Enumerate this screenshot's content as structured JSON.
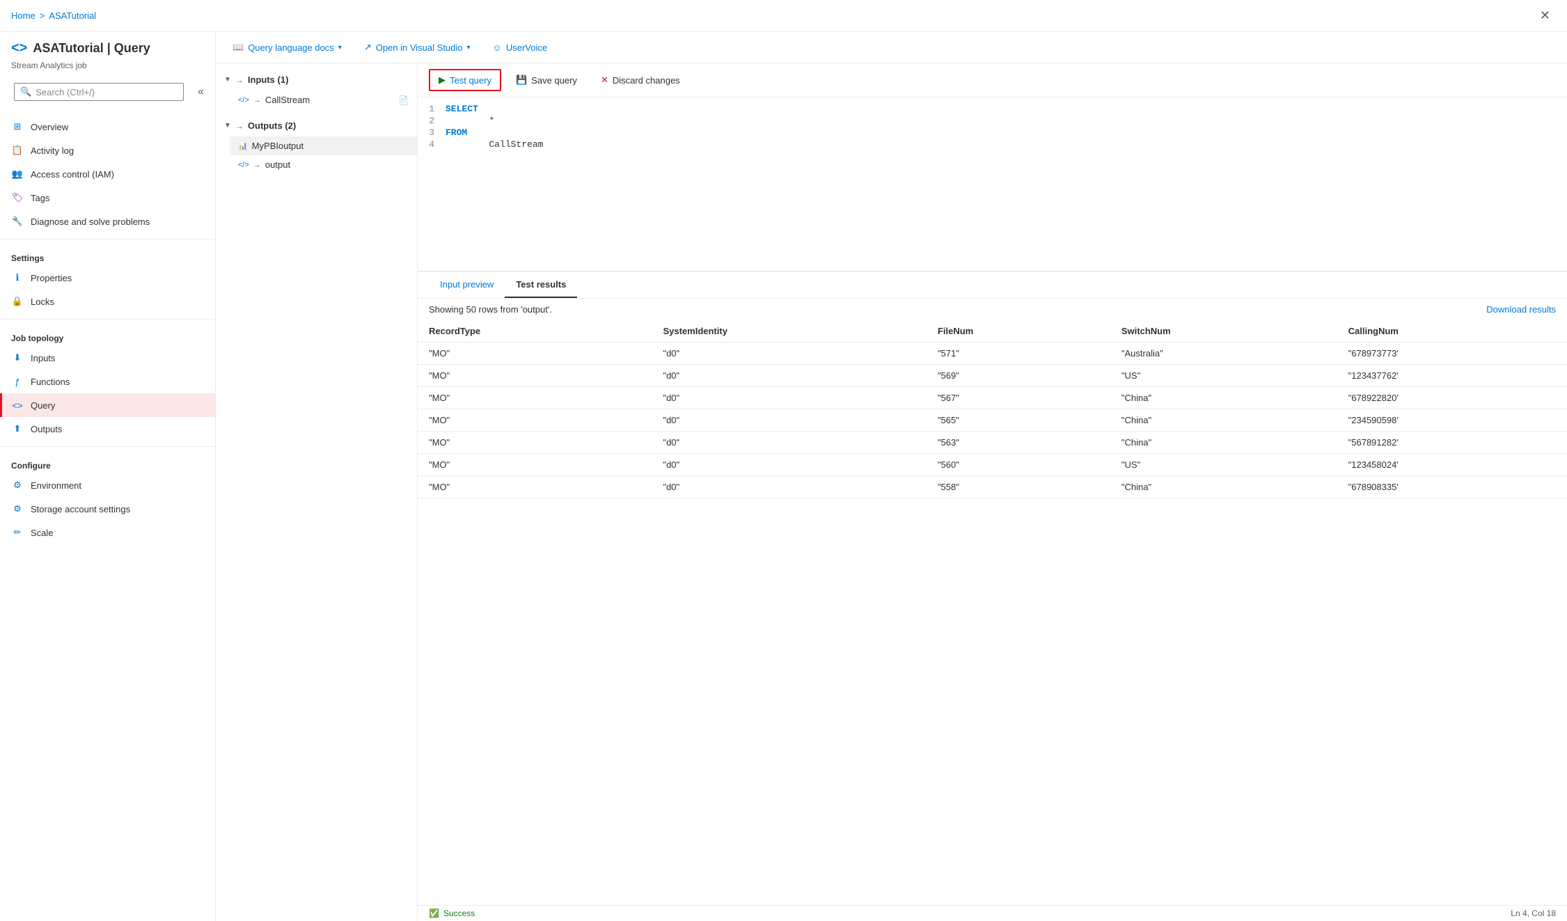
{
  "breadcrumb": {
    "home": "Home",
    "separator": ">",
    "current": "ASATutorial"
  },
  "header": {
    "icon": "<>",
    "title": "ASATutorial | Query",
    "subtitle": "Stream Analytics job",
    "print_icon": "🖨"
  },
  "search": {
    "placeholder": "Search (Ctrl+/)"
  },
  "nav": {
    "top_items": [
      {
        "id": "overview",
        "label": "Overview",
        "icon": "grid"
      },
      {
        "id": "activity-log",
        "label": "Activity log",
        "icon": "list"
      },
      {
        "id": "access-control",
        "label": "Access control (IAM)",
        "icon": "people"
      },
      {
        "id": "tags",
        "label": "Tags",
        "icon": "tag"
      },
      {
        "id": "diagnose",
        "label": "Diagnose and solve problems",
        "icon": "wrench"
      }
    ],
    "settings_label": "Settings",
    "settings_items": [
      {
        "id": "properties",
        "label": "Properties",
        "icon": "info"
      },
      {
        "id": "locks",
        "label": "Locks",
        "icon": "lock"
      }
    ],
    "job_topology_label": "Job topology",
    "job_topology_items": [
      {
        "id": "inputs",
        "label": "Inputs",
        "icon": "input"
      },
      {
        "id": "functions",
        "label": "Functions",
        "icon": "functions"
      },
      {
        "id": "query",
        "label": "Query",
        "icon": "query",
        "active": true
      },
      {
        "id": "outputs",
        "label": "Outputs",
        "icon": "output"
      }
    ],
    "configure_label": "Configure",
    "configure_items": [
      {
        "id": "environment",
        "label": "Environment",
        "icon": "env"
      },
      {
        "id": "storage-account-settings",
        "label": "Storage account settings",
        "icon": "storage"
      },
      {
        "id": "scale",
        "label": "Scale",
        "icon": "scale"
      }
    ]
  },
  "toolbar_top": {
    "query_docs_label": "Query language docs",
    "open_vs_label": "Open in Visual Studio",
    "uservoice_label": "UserVoice"
  },
  "query_toolbar": {
    "test_query_label": "Test query",
    "save_query_label": "Save query",
    "discard_changes_label": "Discard changes"
  },
  "tree": {
    "inputs_label": "Inputs (1)",
    "inputs_items": [
      {
        "id": "callstream",
        "label": "CallStream",
        "has_file": true
      }
    ],
    "outputs_label": "Outputs (2)",
    "outputs_items": [
      {
        "id": "mypbloutput",
        "label": "MyPBIoutput"
      },
      {
        "id": "output",
        "label": "output"
      }
    ]
  },
  "code": {
    "lines": [
      {
        "num": "1",
        "tokens": [
          {
            "text": "SELECT",
            "class": "kw-select"
          }
        ]
      },
      {
        "num": "2",
        "tokens": [
          {
            "text": "        *",
            "class": "code-text"
          }
        ]
      },
      {
        "num": "3",
        "tokens": [
          {
            "text": "FROM",
            "class": "kw-from"
          }
        ]
      },
      {
        "num": "4",
        "tokens": [
          {
            "text": "        CallStream",
            "class": "code-text"
          }
        ]
      }
    ]
  },
  "results": {
    "tabs": [
      {
        "id": "input-preview",
        "label": "Input preview",
        "active": false
      },
      {
        "id": "test-results",
        "label": "Test results",
        "active": true
      }
    ],
    "info_text": "Showing 50 rows from 'output'.",
    "download_label": "Download results",
    "columns": [
      "RecordType",
      "SystemIdentity",
      "FileNum",
      "SwitchNum",
      "CallingNum"
    ],
    "rows": [
      [
        "\"MO\"",
        "\"d0\"",
        "\"571\"",
        "\"Australia\"",
        "\"678973773'"
      ],
      [
        "\"MO\"",
        "\"d0\"",
        "\"569\"",
        "\"US\"",
        "\"123437762'"
      ],
      [
        "\"MO\"",
        "\"d0\"",
        "\"567\"",
        "\"China\"",
        "\"678922820'"
      ],
      [
        "\"MO\"",
        "\"d0\"",
        "\"565\"",
        "\"China\"",
        "\"234590598'"
      ],
      [
        "\"MO\"",
        "\"d0\"",
        "\"563\"",
        "\"China\"",
        "\"567891282'"
      ],
      [
        "\"MO\"",
        "\"d0\"",
        "\"560\"",
        "\"US\"",
        "\"123458024'"
      ],
      [
        "\"MO\"",
        "\"d0\"",
        "\"558\"",
        "\"China\"",
        "\"678908335'"
      ]
    ]
  },
  "status": {
    "success_label": "Success",
    "cursor_pos": "Ln 4, Col 18"
  }
}
